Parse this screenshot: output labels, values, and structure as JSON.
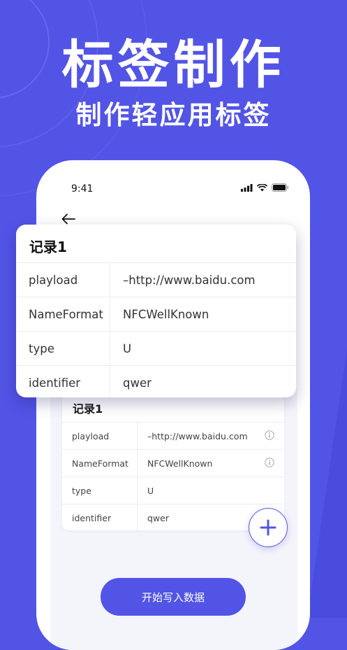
{
  "hero": {
    "title": "标签制作",
    "subtitle": "制作轻应用标签"
  },
  "status": {
    "time": "9:41"
  },
  "floating_card": {
    "title": "记录1",
    "rows": [
      {
        "key": "playload",
        "value": "–http://www.baidu.com"
      },
      {
        "key": "NameFormat",
        "value": "NFCWellKnown"
      },
      {
        "key": "type",
        "value": "U"
      },
      {
        "key": "identifier",
        "value": "qwer"
      }
    ]
  },
  "record_card": {
    "title": "记录1",
    "rows": [
      {
        "key": "playload",
        "value": "–http://www.baidu.com",
        "info": true
      },
      {
        "key": "NameFormat",
        "value": "NFCWellKnown",
        "info": true
      },
      {
        "key": "type",
        "value": "U"
      },
      {
        "key": "identifier",
        "value": "qwer"
      }
    ]
  },
  "actions": {
    "start_label": "开始写入数据"
  },
  "colors": {
    "accent": "#5254e6",
    "background": "#5254e6"
  },
  "icons": [
    "back-arrow-icon",
    "signal-icon",
    "wifi-icon",
    "battery-icon",
    "info-icon",
    "plus-icon"
  ]
}
